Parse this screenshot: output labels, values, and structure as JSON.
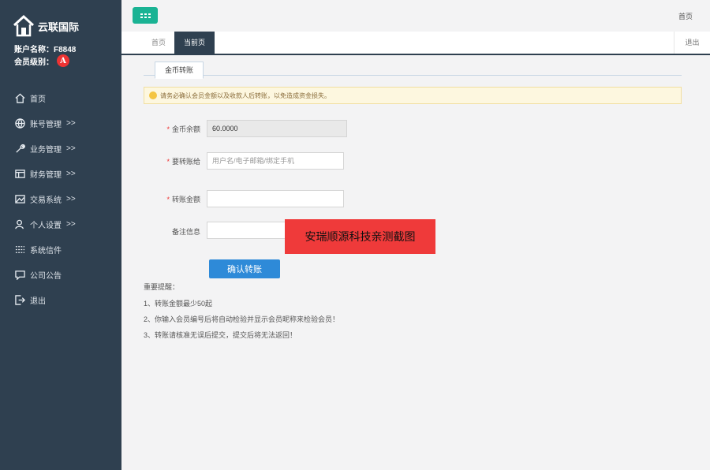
{
  "brand": {
    "name": "云联国际"
  },
  "account": {
    "name_line": "账户名称：F8848",
    "level_label": "会员级别：",
    "level_badge": "A"
  },
  "nav": {
    "items": [
      {
        "label": "首页",
        "arrow": "",
        "icon": "home-icon"
      },
      {
        "label": "账号管理",
        "arrow": ">>",
        "icon": "globe-icon"
      },
      {
        "label": "业务管理",
        "arrow": ">>",
        "icon": "wrench-icon"
      },
      {
        "label": "财务管理",
        "arrow": ">>",
        "icon": "ledger-icon"
      },
      {
        "label": "交易系统",
        "arrow": ">>",
        "icon": "image-chart-icon"
      },
      {
        "label": "个人设置",
        "arrow": ">>",
        "icon": "users-icon"
      },
      {
        "label": "系统信件",
        "arrow": "",
        "icon": "list-icon"
      },
      {
        "label": "公司公告",
        "arrow": "",
        "icon": "chat-icon"
      },
      {
        "label": "退出",
        "arrow": "",
        "icon": "exit-icon"
      }
    ]
  },
  "topbar": {
    "home_link": "首页"
  },
  "tabs": {
    "home": "首页",
    "current": "当前页",
    "logout": "退出"
  },
  "subtab": {
    "label": "金币转账"
  },
  "notice": {
    "text": "请务必确认会员金额以及收款人后转账，以免造成资金损失。"
  },
  "form": {
    "balance_label": "金币余额",
    "balance_value": "60.0000",
    "recipient_label": "要转账给",
    "recipient_placeholder": "用户名/电子邮箱/绑定手机",
    "amount_label": "转账金额",
    "remark_label": "备注信息",
    "submit_label": "确认转账"
  },
  "tips": {
    "title": "重要提醒：",
    "items": [
      "1、转账金额最少50起",
      "2、你输入会员编号后将自动检验并显示会员昵称来检验会员！",
      "3、转账请核准无误后提交，提交后将无法返回！"
    ]
  },
  "watermark": {
    "text": "安瑞顺源科技亲测截图"
  },
  "colors": {
    "sidebar": "#2f4050",
    "accent": "#1ab394",
    "button": "#2e8ad8",
    "stamp": "#ef3a3a"
  }
}
